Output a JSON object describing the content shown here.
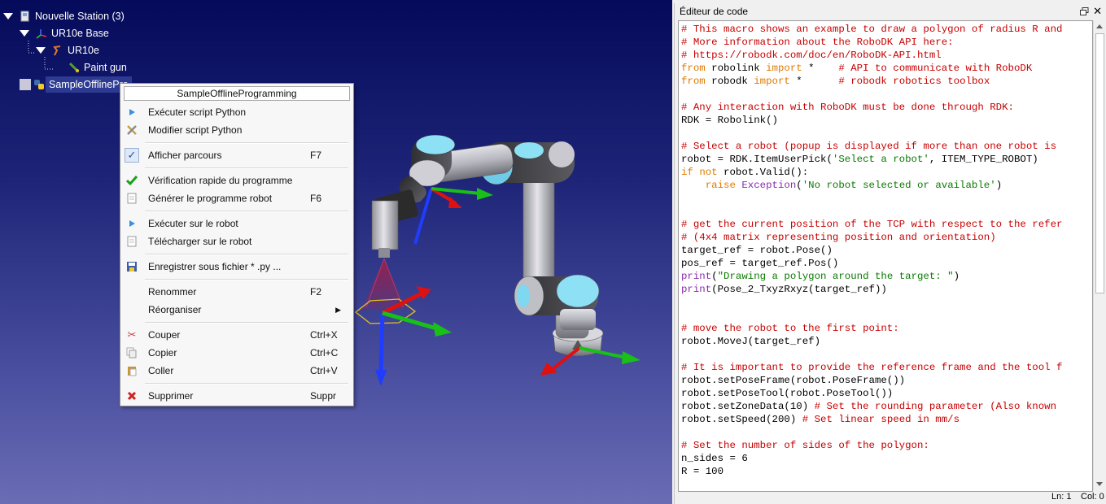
{
  "tree": {
    "station": "Nouvelle Station (3)",
    "base": "UR10e Base",
    "robot": "UR10e",
    "tool": "Paint gun",
    "program": "SampleOfflinePro"
  },
  "menu": {
    "title": "SampleOfflineProgramming",
    "items": [
      {
        "icon": "play-icon",
        "label": "Exécuter script Python",
        "shortcut": ""
      },
      {
        "icon": "edit-tools-icon",
        "label": "Modifier script Python",
        "shortcut": ""
      },
      {
        "icon": "check-icon",
        "label": "Afficher parcours",
        "shortcut": "F7"
      },
      {
        "icon": "green-check-icon",
        "label": "Vérification rapide du programme",
        "shortcut": ""
      },
      {
        "icon": "document-icon",
        "label": "Générer le programme robot",
        "shortcut": "F6"
      },
      {
        "icon": "play-icon",
        "label": "Exécuter sur le robot",
        "shortcut": ""
      },
      {
        "icon": "document-icon",
        "label": "Télécharger sur le robot",
        "shortcut": ""
      },
      {
        "icon": "save-icon",
        "label": "Enregistrer sous fichier * .py ...",
        "shortcut": ""
      },
      {
        "icon": "",
        "label": "Renommer",
        "shortcut": "F2"
      },
      {
        "icon": "",
        "label": "Réorganiser",
        "shortcut": ""
      },
      {
        "icon": "scissors-icon",
        "label": "Couper",
        "shortcut": "Ctrl+X"
      },
      {
        "icon": "copy-icon",
        "label": "Copier",
        "shortcut": "Ctrl+C"
      },
      {
        "icon": "paste-icon",
        "label": "Coller",
        "shortcut": "Ctrl+V"
      },
      {
        "icon": "delete-icon",
        "label": "Supprimer",
        "shortcut": "Suppr"
      }
    ]
  },
  "editor": {
    "title": "Éditeur de code",
    "status_line": "Ln: 1",
    "status_col": "Col: 0",
    "lines": [
      [
        [
          "cm",
          "# This macro shows an example to draw a polygon of radius R and"
        ]
      ],
      [
        [
          "cm",
          "# More information about the RoboDK API here:"
        ]
      ],
      [
        [
          "cm",
          "# https://robodk.com/doc/en/RoboDK-API.html"
        ]
      ],
      [
        [
          "kw",
          "from"
        ],
        [
          "",
          " robolink "
        ],
        [
          "kw",
          "import"
        ],
        [
          "",
          " *    "
        ],
        [
          "cm",
          "# API to communicate with RoboDK"
        ]
      ],
      [
        [
          "kw",
          "from"
        ],
        [
          "",
          " robodk "
        ],
        [
          "kw",
          "import"
        ],
        [
          "",
          " *      "
        ],
        [
          "cm",
          "# robodk robotics toolbox"
        ]
      ],
      [
        [
          "",
          ""
        ]
      ],
      [
        [
          "cm",
          "# Any interaction with RoboDK must be done through RDK:"
        ]
      ],
      [
        [
          "",
          "RDK = Robolink()"
        ]
      ],
      [
        [
          "",
          ""
        ]
      ],
      [
        [
          "cm",
          "# Select a robot (popup is displayed if more than one robot is"
        ]
      ],
      [
        [
          "",
          "robot = RDK.ItemUserPick("
        ],
        [
          "str",
          "'Select a robot'"
        ],
        [
          "",
          ", ITEM_TYPE_ROBOT)"
        ]
      ],
      [
        [
          "kw",
          "if"
        ],
        [
          "",
          " "
        ],
        [
          "kw",
          "not"
        ],
        [
          "",
          " robot.Valid():"
        ]
      ],
      [
        [
          "",
          "    "
        ],
        [
          "kw",
          "raise"
        ],
        [
          "",
          " "
        ],
        [
          "kw2",
          "Exception"
        ],
        [
          "",
          "("
        ],
        [
          "str",
          "'No robot selected or available'"
        ],
        [
          "",
          ")"
        ]
      ],
      [
        [
          "",
          ""
        ]
      ],
      [
        [
          "",
          ""
        ]
      ],
      [
        [
          "cm",
          "# get the current position of the TCP with respect to the refer"
        ]
      ],
      [
        [
          "cm",
          "# (4x4 matrix representing position and orientation)"
        ]
      ],
      [
        [
          "",
          "target_ref = robot.Pose()"
        ]
      ],
      [
        [
          "",
          "pos_ref = target_ref.Pos()"
        ]
      ],
      [
        [
          "fn",
          "print"
        ],
        [
          "",
          "("
        ],
        [
          "str",
          "\"Drawing a polygon around the target: \""
        ],
        [
          "",
          ")"
        ]
      ],
      [
        [
          "fn",
          "print"
        ],
        [
          "",
          "(Pose_2_TxyzRxyz(target_ref))"
        ]
      ],
      [
        [
          "",
          ""
        ]
      ],
      [
        [
          "",
          ""
        ]
      ],
      [
        [
          "cm",
          "# move the robot to the first point:"
        ]
      ],
      [
        [
          "",
          "robot.MoveJ(target_ref)"
        ]
      ],
      [
        [
          "",
          ""
        ]
      ],
      [
        [
          "cm",
          "# It is important to provide the reference frame and the tool f"
        ]
      ],
      [
        [
          "",
          "robot.setPoseFrame(robot.PoseFrame())"
        ]
      ],
      [
        [
          "",
          "robot.setPoseTool(robot.PoseTool())"
        ]
      ],
      [
        [
          "",
          "robot.setZoneData(10) "
        ],
        [
          "cm",
          "# Set the rounding parameter (Also known"
        ]
      ],
      [
        [
          "",
          "robot.setSpeed(200) "
        ],
        [
          "cm",
          "# Set linear speed in mm/s"
        ]
      ],
      [
        [
          "",
          ""
        ]
      ],
      [
        [
          "cm",
          "# Set the number of sides of the polygon:"
        ]
      ],
      [
        [
          "",
          "n_sides = 6"
        ]
      ],
      [
        [
          "",
          "R = 100"
        ]
      ]
    ]
  }
}
